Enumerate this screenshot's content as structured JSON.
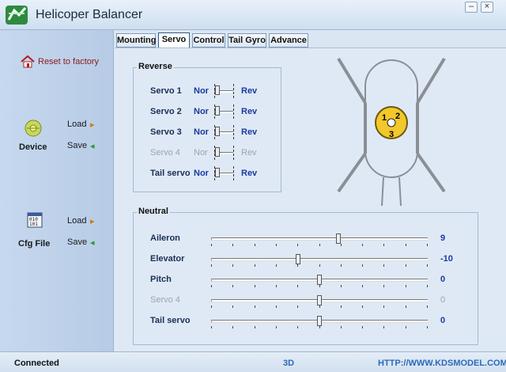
{
  "window": {
    "title": "Helicoper Balancer",
    "min_symbol": "–",
    "close_symbol": "×"
  },
  "sidebar": {
    "reset_label": "Reset to factory",
    "device": {
      "label": "Device",
      "load": "Load",
      "save": "Save"
    },
    "cfg": {
      "label": "Cfg File",
      "load": "Load",
      "save": "Save",
      "icon_text_1": "010",
      "icon_text_2": "101"
    }
  },
  "tabs": [
    "Mounting",
    "Servo",
    "Control",
    "Tail Gyro",
    "Advance"
  ],
  "active_tab": "Servo",
  "reverse": {
    "title": "Reverse",
    "nor": "Nor",
    "rev": "Rev",
    "rows": [
      {
        "label": "Servo 1",
        "disabled": false,
        "value": "Nor"
      },
      {
        "label": "Servo 2",
        "disabled": false,
        "value": "Nor"
      },
      {
        "label": "Servo 3",
        "disabled": false,
        "value": "Nor"
      },
      {
        "label": "Servo 4",
        "disabled": true,
        "value": "Nor"
      },
      {
        "label": "Tail servo",
        "disabled": false,
        "value": "Nor"
      }
    ]
  },
  "diagram": {
    "servo_numbers": [
      "1",
      "2",
      "3"
    ]
  },
  "neutral": {
    "title": "Neutral",
    "range": [
      -50,
      50
    ],
    "rows": [
      {
        "label": "Aileron",
        "value": "9",
        "disabled": false
      },
      {
        "label": "Elevator",
        "value": "-10",
        "disabled": false
      },
      {
        "label": "Pitch",
        "value": "0",
        "disabled": false
      },
      {
        "label": "Servo 4",
        "value": "0",
        "disabled": true
      },
      {
        "label": "Tail servo",
        "value": "0",
        "disabled": false
      }
    ]
  },
  "status": {
    "connection": "Connected",
    "mode": "3D",
    "url": "HTTP://WWW.KDSMODEL.COM"
  },
  "colors": {
    "accent": "#1a3aa0",
    "disabled": "#9aa3ae",
    "status_blue": "#2a6ab8",
    "reset_red": "#8b1a1a"
  }
}
